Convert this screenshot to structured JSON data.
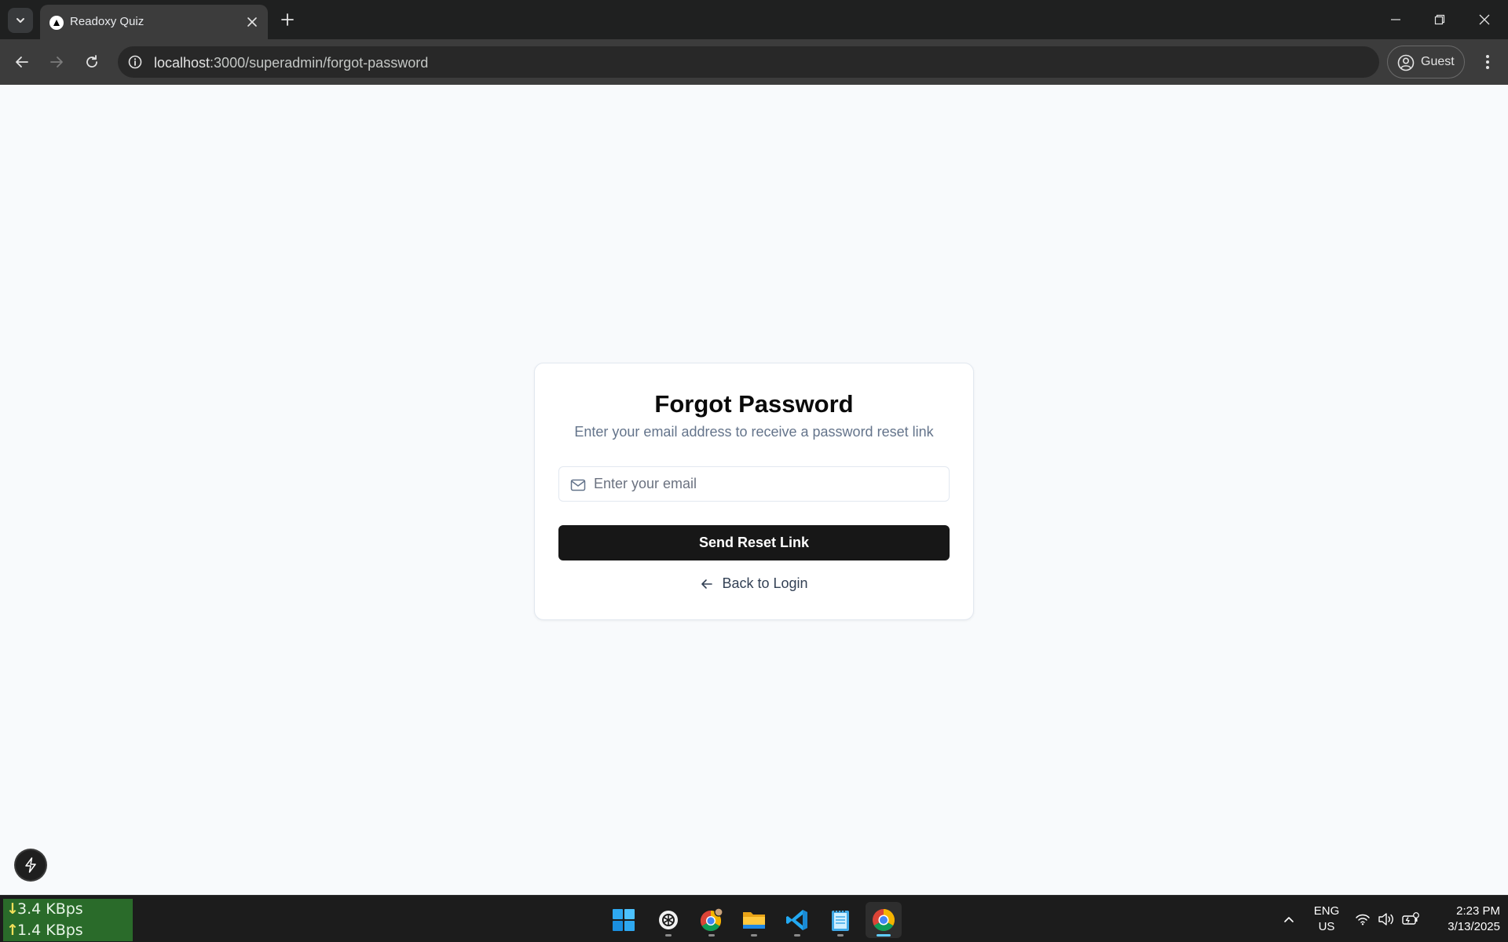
{
  "browser": {
    "tab_title": "Readoxy Quiz",
    "url_host": "localhost",
    "url_rest": ":3000/superadmin/forgot-password",
    "profile_label": "Guest"
  },
  "page": {
    "title": "Forgot Password",
    "subtitle": "Enter your email address to receive a password reset link",
    "email_placeholder": "Enter your email",
    "email_value": "",
    "submit_label": "Send Reset Link",
    "back_label": "Back to Login"
  },
  "taskbar": {
    "net_down": "3.4 KBps",
    "net_up": "1.4 KBps",
    "apps": [
      "start",
      "chatgpt",
      "chrome-profile",
      "file-explorer",
      "vs-code",
      "notepad",
      "chrome"
    ],
    "lang_line1": "ENG",
    "lang_line2": "US",
    "time": "2:23 PM",
    "date": "3/13/2025"
  },
  "colors": {
    "page_bg": "#f8fafc",
    "button_bg": "#171717",
    "chrome_dark": "#1f2020",
    "netmon_bg": "#2a6b2a",
    "active_indicator": "#60cdff"
  }
}
